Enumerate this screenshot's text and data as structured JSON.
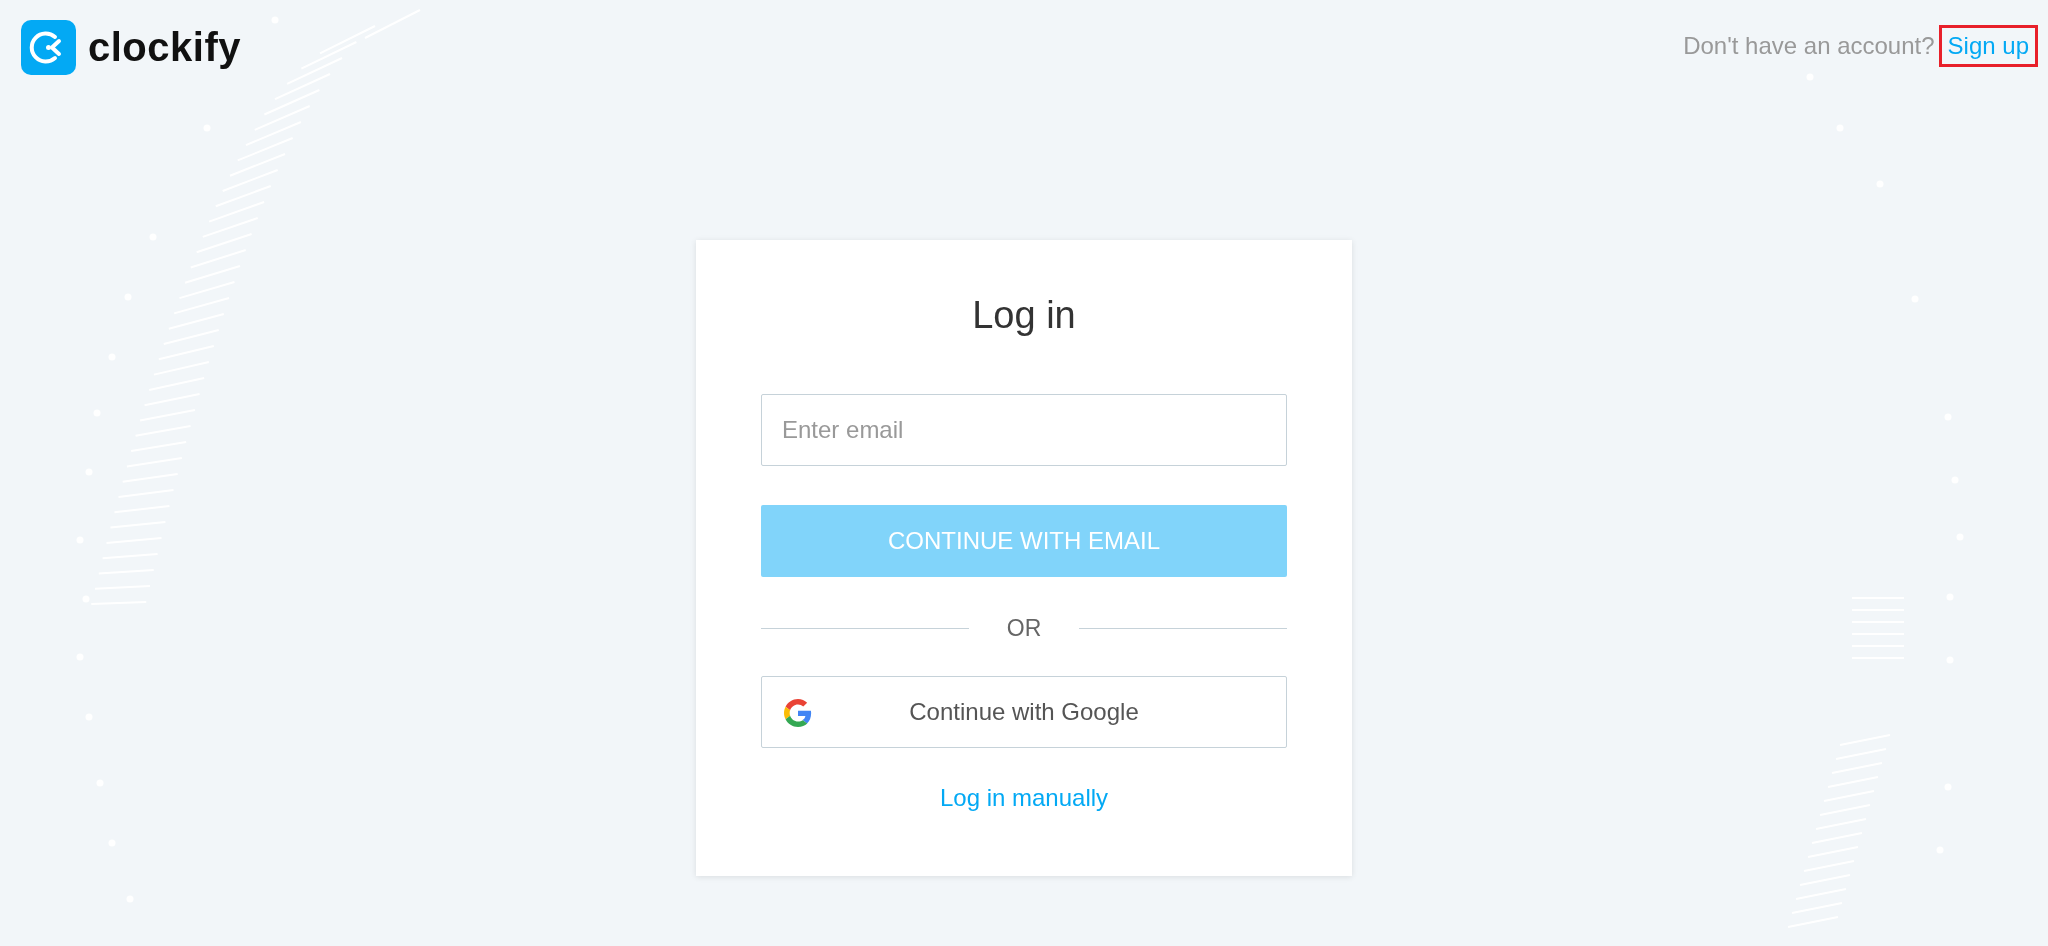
{
  "header": {
    "logo_text": "clockify",
    "prompt": "Don't have an account?",
    "signup_link": {
      "label": "Sign up",
      "highlighted": true
    }
  },
  "login_card": {
    "title": "Log in",
    "email_field": {
      "placeholder": "Enter email"
    },
    "continue_button": {
      "label": "CONTINUE WITH EMAIL",
      "disabled": true
    },
    "divider_text": "OR",
    "google_button": {
      "label": "Continue with Google"
    },
    "manual_link": "Log in manually"
  }
}
